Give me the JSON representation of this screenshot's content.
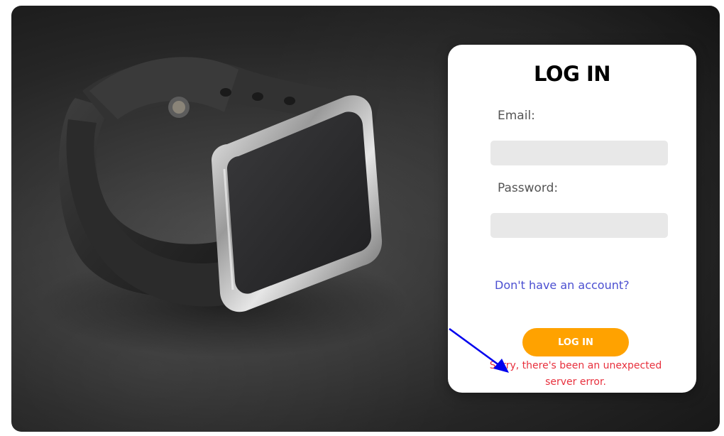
{
  "login_form": {
    "title": "LOG IN",
    "email_label": "Email:",
    "email_value": "",
    "password_label": "Password:",
    "password_value": "",
    "signup_link": "Don't have an account?",
    "submit_label": "LOG IN",
    "error_message": "Sorry, there's been an unexpected server error."
  },
  "colors": {
    "button": "#ffa200",
    "link": "#4b4fd1",
    "error": "#e8303d",
    "input_background": "#e8e8e8",
    "annotation_arrow": "#0000ee"
  },
  "icons": {
    "hero": "smartwatch-image",
    "annotation": "arrow-pointer-icon"
  }
}
